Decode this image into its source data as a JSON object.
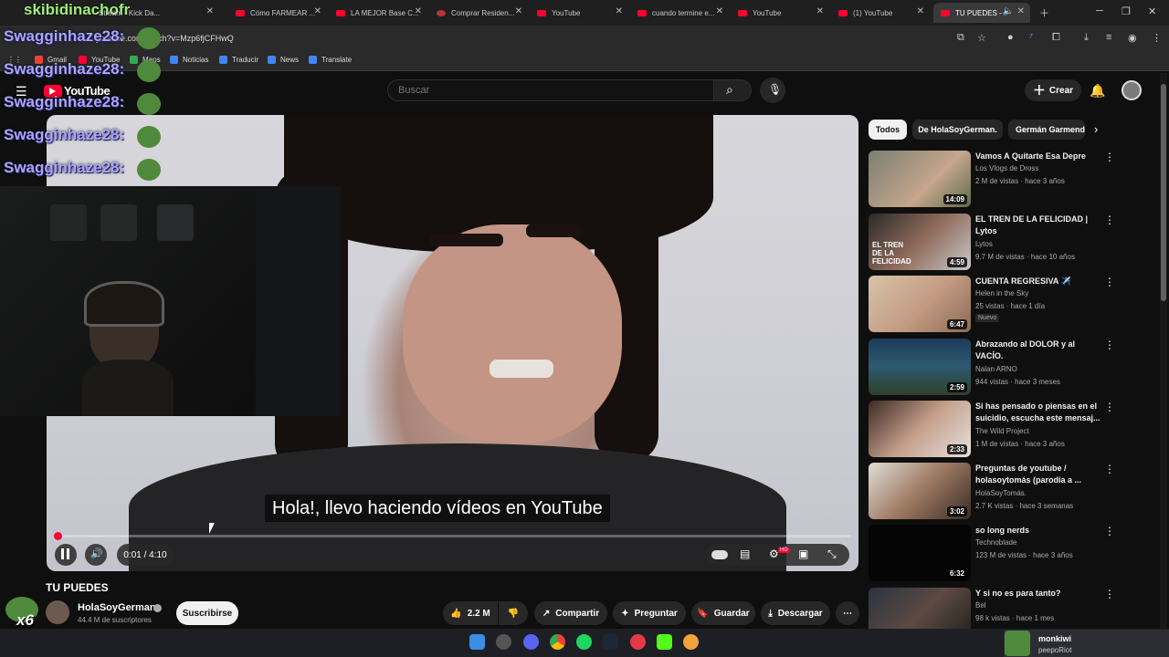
{
  "browser": {
    "tabs": [
      {
        "label": "Stream - Kick Da..."
      },
      {
        "label": "Cómo FARMEAR ..."
      },
      {
        "label": "LA MEJOR Base C..."
      },
      {
        "label": "Comprar Residen..."
      },
      {
        "label": "YouTube"
      },
      {
        "label": "cuando termine e..."
      },
      {
        "label": "YouTube"
      },
      {
        "label": "(1) YouTube"
      },
      {
        "label": "TU PUEDES -"
      }
    ],
    "url": "youtube.com/watch?v=Mzp6fjCFHwQ",
    "bookmarks": [
      "Gmail",
      "YouTube",
      "Maps",
      "Noticias",
      "Traducir",
      "News",
      "Translate"
    ]
  },
  "stream_overlay": {
    "title": "skibidinachofr",
    "chat_lines": [
      "Swagginhaze28:",
      "Swagginhaze28:",
      "Swagginhaze28:",
      "Swagginhaze28:",
      "Swagginhaze28:"
    ],
    "multiplier": "x6",
    "viewer_name": "monkiwi",
    "viewer_message": "peepoRiot"
  },
  "youtube": {
    "logo": "YouTube",
    "search_placeholder": "Buscar",
    "create_label": "Crear"
  },
  "player": {
    "subtitle": "Hola!, llevo haciendo vídeos en YouTube",
    "time": "0:01 / 4:10",
    "progress": 0.004,
    "hd_badge": "HD"
  },
  "video": {
    "title": "TU PUEDES",
    "channel": "HolaSoyGerman.",
    "subscribers": "44.4 M de suscriptores",
    "subscribe_label": "Suscribirse",
    "likes": "2.2 M",
    "share_label": "Compartir",
    "ask_label": "Preguntar",
    "save_label": "Guardar",
    "download_label": "Descargar"
  },
  "sidebar": {
    "chips": [
      "Todos",
      "De HolaSoyGerman.",
      "Germán Garmendia"
    ],
    "recommendations": [
      {
        "title": "Vamos A Quitarte Esa Depre",
        "channel": "Los Vlogs de Dross",
        "meta": "2 M de vistas · hace 3 años",
        "duration": "14:09",
        "verified": true
      },
      {
        "title": "EL TREN DE LA FELICIDAD | Lytos",
        "channel": "Lytos",
        "meta": "9.7 M de vistas · hace 10 años",
        "duration": "4:59",
        "verified": true,
        "thumb_text": "EL TREN DE LA FELICIDAD"
      },
      {
        "title": "CUENTA REGRESIVA ✈️",
        "channel": "Helen in the Sky",
        "meta": "25 vistas · hace 1 día",
        "duration": "6:47",
        "badge": "Nuevo"
      },
      {
        "title": "Abrazando al DOLOR y al VACÍO.",
        "channel": "Nalan ARNO",
        "meta": "944 vistas · hace 3 meses",
        "duration": "2:59"
      },
      {
        "title": "Si has pensado o piensas en el suicidio, escucha este mensaj...",
        "channel": "The Wild Project",
        "meta": "1 M de vistas · hace 3 años",
        "duration": "2:33",
        "verified": true
      },
      {
        "title": "Preguntas de youtube / holasoytomás (parodia a ...",
        "channel": "HolaSoyTomás.",
        "meta": "2.7 K vistas · hace 3 semanas",
        "duration": "3:02"
      },
      {
        "title": "so long nerds",
        "channel": "Technoblade",
        "meta": "123 M de vistas · hace 3 años",
        "duration": "6:32",
        "verified": true
      },
      {
        "title": "Y si no es para tanto?",
        "channel": "Bel",
        "meta": "98 k vistas · hace 1 mes",
        "verified": true
      }
    ]
  },
  "colors": {
    "accent": "#ff0033",
    "background": "#0f0f0f",
    "chat_name": "#a9a6ff",
    "stream_title": "#9ef07a"
  }
}
